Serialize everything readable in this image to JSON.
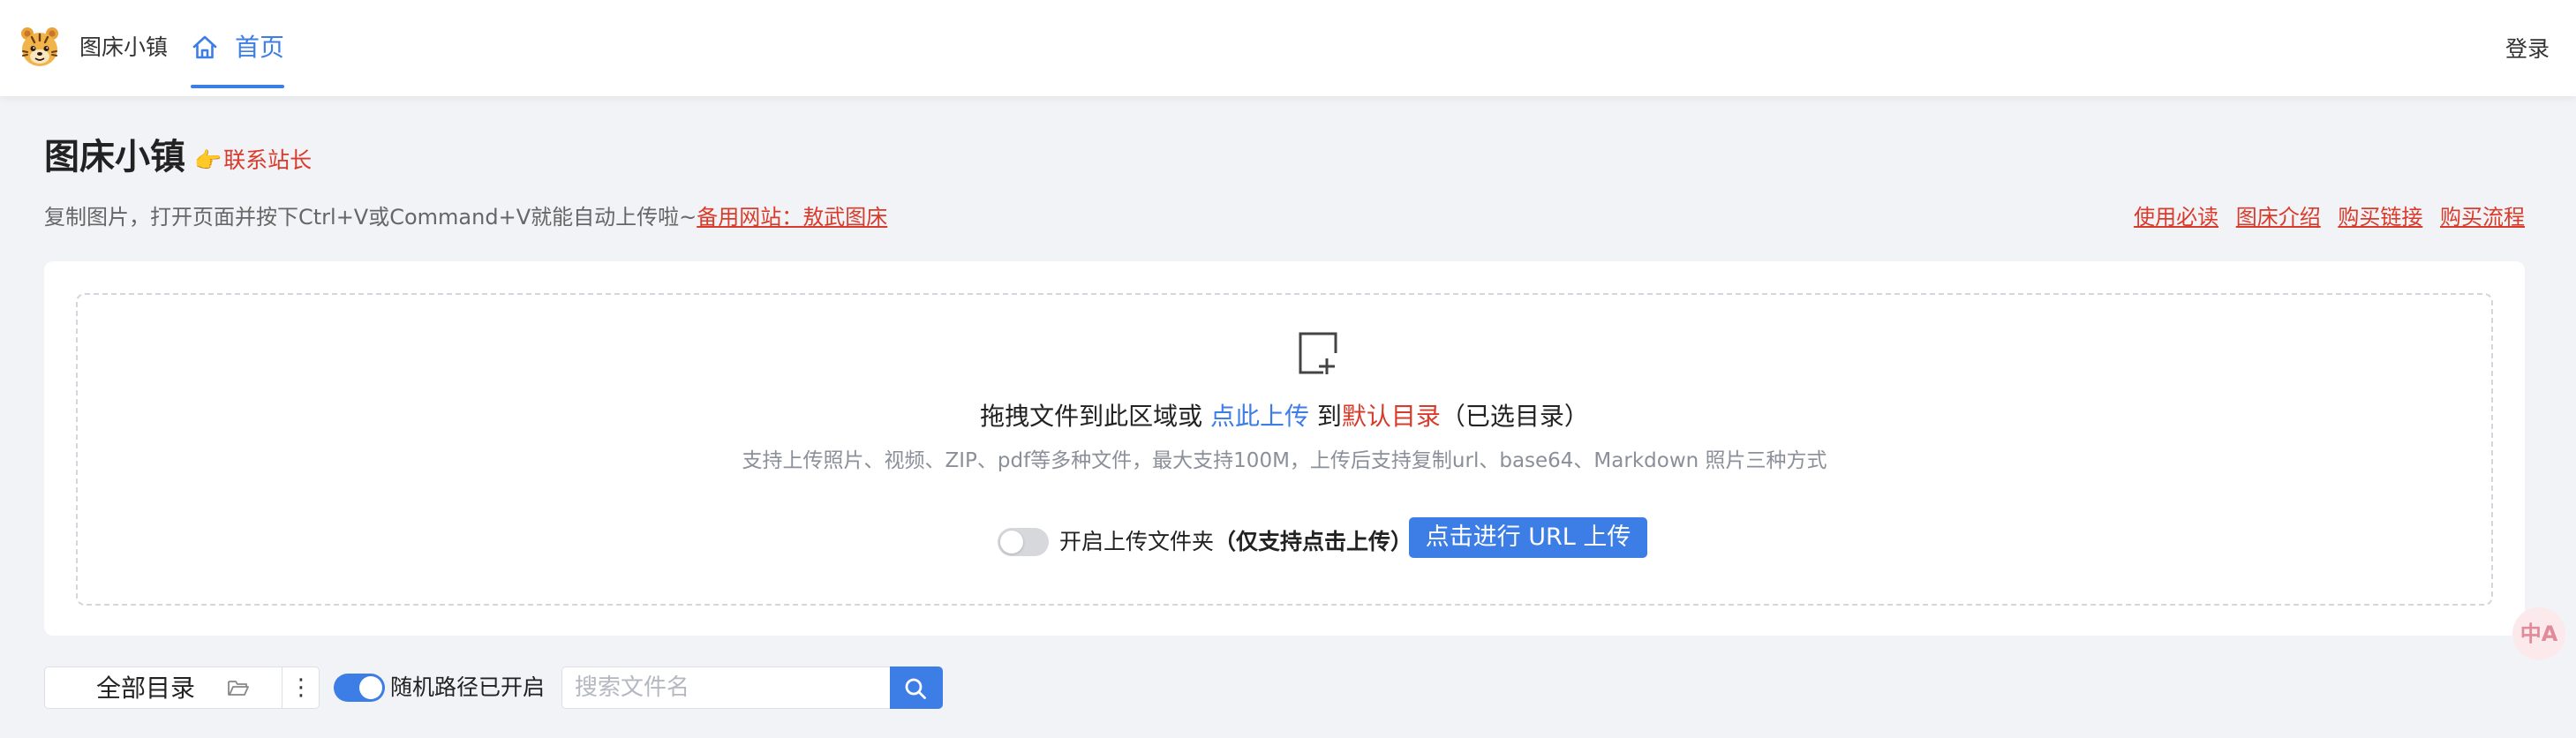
{
  "nav": {
    "brand": "图床小镇",
    "home": "首页",
    "login": "登录"
  },
  "header": {
    "title": "图床小镇",
    "contact": "联系站长",
    "contact_emoji": "👉",
    "subtitle_prefix": "复制图片，打开页面并按下Ctrl+V或Command+V就能自动上传啦~",
    "backup_link": "备用网站：敖武图床",
    "links": [
      "使用必读",
      "图床介绍",
      "购买链接",
      "购买流程"
    ]
  },
  "upload": {
    "drag_text": "拖拽文件到此区域或 ",
    "click_text": "点此上传",
    "to_text": " 到",
    "dir_text": "默认目录",
    "selected_text": "（已选目录）",
    "support_text": "支持上传照片、视频、ZIP、pdf等多种文件，最大支持100M，上传后支持复制url、base64、Markdown 照片三种方式",
    "folder_toggle_label": "开启上传文件夹",
    "folder_toggle_note": "（仅支持点击上传）",
    "folder_toggle_on": false,
    "url_button": "点击进行 URL 上传"
  },
  "toolbar": {
    "directory": "全部目录",
    "more": "⋮",
    "random_path_label": "随机路径已开启",
    "random_path_on": true,
    "search_placeholder": "搜索文件名"
  },
  "translate": {
    "icon": "translate-icon",
    "glyph": "中A"
  },
  "colors": {
    "accent": "#3d7de6",
    "link_red": "#d93b2b",
    "background": "#f2f3f6"
  }
}
